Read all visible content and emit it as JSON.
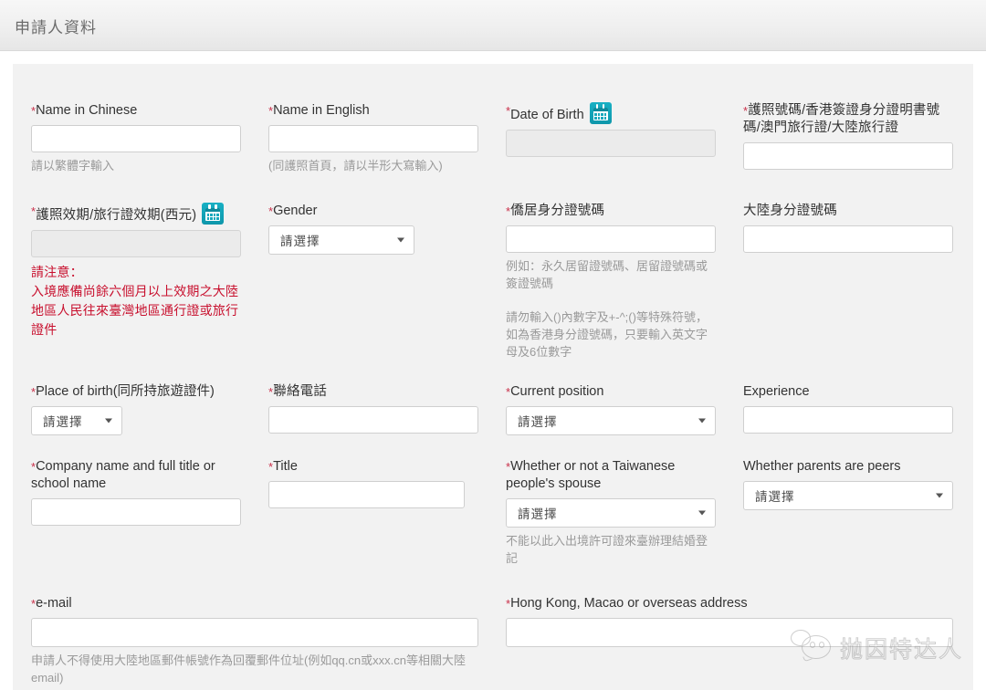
{
  "header": {
    "title": "申請人資料"
  },
  "icons": {
    "calendar": "calendar-icon"
  },
  "select_placeholder": "請選擇",
  "fields": {
    "name_chinese": {
      "label": "Name in Chinese",
      "required": "*",
      "value": "",
      "hint": "請以繁體字輸入"
    },
    "name_english": {
      "label": "Name in English",
      "required": "*",
      "value": "",
      "hint": "(同護照首頁，請以半形大寫輸入)"
    },
    "date_of_birth": {
      "label": "Date of Birth",
      "required": "*",
      "value": ""
    },
    "passport_number": {
      "label": "護照號碼/香港簽證身分證明書號碼/澳門旅行證/大陸旅行證",
      "required": "*",
      "value": ""
    },
    "passport_validity": {
      "label": "護照效期/旅行證效期(西元)",
      "required": "*",
      "value": "",
      "warning": "請注意：\n入境應備尚餘六個月以上效期之大陸地區人民往來臺灣地區通行證或旅行證件"
    },
    "gender": {
      "label": "Gender",
      "required": "*",
      "value": "請選擇"
    },
    "overseas_id": {
      "label": "僑居身分證號碼",
      "required": "*",
      "value": "",
      "hint1": "例如：永久居留證號碼、居留證號碼或簽證號碼",
      "hint2": "請勿輸入()內數字及+-^;()等特殊符號，如為香港身分證號碼，只要輸入英文字母及6位數字"
    },
    "mainland_id": {
      "label": "大陸身分證號碼",
      "required": "",
      "value": ""
    },
    "place_of_birth": {
      "label": "Place of birth(同所持旅遊證件)",
      "required": "*",
      "value": "請選擇"
    },
    "contact_phone": {
      "label": "聯絡電話",
      "required": "*",
      "value": ""
    },
    "current_position": {
      "label": "Current position",
      "required": "*",
      "value": "請選擇"
    },
    "experience": {
      "label": "Experience",
      "required": "",
      "value": ""
    },
    "company_name": {
      "label": "Company name and full title or school name",
      "required": "*",
      "value": ""
    },
    "title": {
      "label": "Title",
      "required": "*",
      "value": ""
    },
    "taiwanese_spouse": {
      "label": "Whether or not a Taiwanese people's spouse",
      "required": "*",
      "value": "請選擇",
      "hint": "不能以此入出境許可證來臺辦理結婚登記"
    },
    "parents_peers": {
      "label": "Whether parents are peers",
      "required": "",
      "value": "請選擇"
    },
    "email": {
      "label": "e-mail",
      "required": "*",
      "value": "",
      "hint": "申請人不得使用大陸地區郵件帳號作為回覆郵件位址(例如qq.cn或xxx.cn等相關大陸email)"
    },
    "overseas_address": {
      "label": "Hong Kong, Macao or overseas address",
      "required": "*",
      "value": ""
    }
  },
  "watermark": {
    "text": "抛因特达人"
  },
  "colors": {
    "required_asterisk": "#c9304a",
    "warning_text": "#c8102e",
    "panel_background": "#f2f2f2",
    "calendar_icon": "#18b0c4",
    "hint_text": "#9a9a9a"
  }
}
